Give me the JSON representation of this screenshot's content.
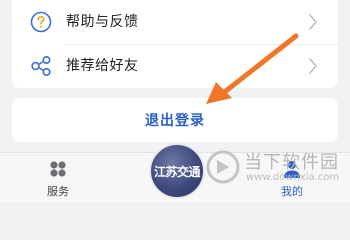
{
  "menu": {
    "items": [
      {
        "label": "帮助与反馈",
        "icon": "question-circle-icon"
      },
      {
        "label": "推荐给好友",
        "icon": "share-nodes-icon"
      }
    ]
  },
  "logout": {
    "label": "退出登录"
  },
  "tabbar": {
    "services": {
      "label": "服务",
      "icon": "grid-icon"
    },
    "center": {
      "label": "江苏交通",
      "icon": "app-logo-icon"
    },
    "mine": {
      "label": "我的",
      "icon": "person-icon"
    }
  },
  "watermark": {
    "title": "当下软件园",
    "url": "www.downxia.com"
  },
  "colors": {
    "accent": "#2a5fc9",
    "annotation_arrow": "#f0772a",
    "background": "#f1f2f4"
  }
}
